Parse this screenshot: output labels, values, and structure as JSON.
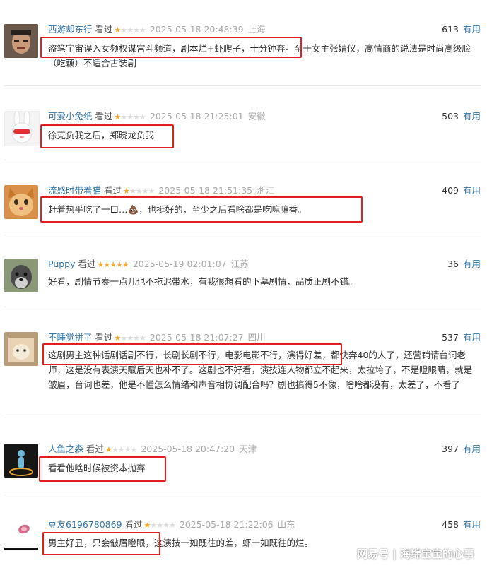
{
  "status_label": "看过",
  "useful_label": "有用",
  "watermark": "网易号 | 海绵宝宝的心事",
  "colors": {
    "highlight": "#e02020",
    "link": "#3377aa",
    "star": "#f5a623"
  },
  "reviews": [
    {
      "user": "西游却东行",
      "rating": 1,
      "time": "2025-05-18 20:48:39",
      "location": "上海",
      "votes": "613",
      "text": "盗笔宇宙误入女频权谋宫斗频道，剧本烂+虾爬子，十分钟弃。至于女主张婧仪，高情商的说法是时尚高级脸（吃藕）不适合古装剧"
    },
    {
      "user": "可爱小兔纸",
      "rating": 1,
      "time": "2025-05-18 21:25:01",
      "location": "安徽",
      "votes": "503",
      "text": "徐克负我之后，郑晓龙负我"
    },
    {
      "user": "流感时带着猫",
      "rating": 1,
      "time": "2025-05-18 21:51:35",
      "location": "浙江",
      "votes": "409",
      "text": "赶着热乎吃了一口…💩，也挺好的，至少之后看啥都是吃嘛嘛香。"
    },
    {
      "user": "Puppy",
      "rating": 5,
      "time": "2025-05-19 02:01:07",
      "location": "江苏",
      "votes": "36",
      "text": "好看，剧情节奏一点儿也不拖泥带水，有我很想看的下墓剧情，品质正剧不错。"
    },
    {
      "user": "不睡觉拼了",
      "rating": 1,
      "time": "2025-05-18 21:07:27",
      "location": "四川",
      "votes": "537",
      "text": "这剧男主这种话剧话剧不行，长剧长剧不行，电影电影不行，演得好差，都快奔40的人了，还营销请台词老师，这是没有表演天赋后天也补不了。这剧也不好看，演技连人物都立不起来，太拉垮了，不是瞪眼睛，就是皱眉，台词也差，他是不懂怎么情绪和声音相协调配合吗？剧也搞得5不像，啥啥都没有，太差了，不看了"
    },
    {
      "user": "人鱼之森",
      "rating": 1,
      "time": "2025-05-18 20:47:20",
      "location": "天津",
      "votes": "397",
      "text": "看看他啥时候被资本抛弃"
    },
    {
      "user": "豆友6196780869",
      "rating": 1,
      "time": "2025-05-18 21:22:06",
      "location": "山东",
      "votes": "458",
      "text": "男主好丑，只会皱眉瞪眼，这演技一如既往的差，虾一如既往的烂。"
    }
  ]
}
